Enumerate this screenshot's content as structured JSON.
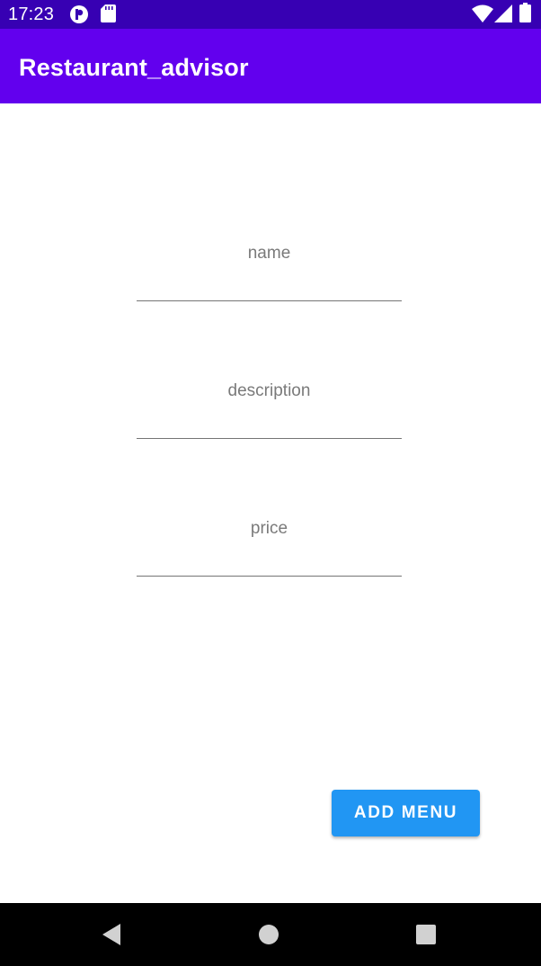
{
  "status_bar": {
    "time": "17:23",
    "icons": [
      "notification-app-icon",
      "sd-card-icon",
      "wifi-icon",
      "cell-signal-icon",
      "battery-icon"
    ]
  },
  "app_bar": {
    "title": "Restaurant_advisor",
    "color": "#6200ee",
    "status_color": "#3700b3"
  },
  "form": {
    "name": {
      "placeholder": "name",
      "value": ""
    },
    "description": {
      "placeholder": "description",
      "value": ""
    },
    "price": {
      "placeholder": "price",
      "value": ""
    }
  },
  "actions": {
    "add_menu_label": "ADD MENU",
    "button_color": "#2196f3"
  },
  "nav_bar": {
    "icons": [
      "back-icon",
      "home-icon",
      "recents-icon"
    ]
  }
}
